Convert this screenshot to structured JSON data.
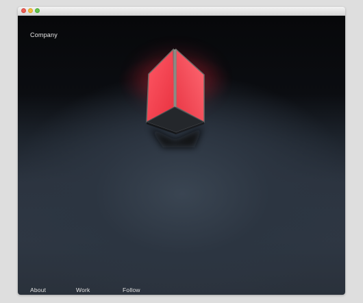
{
  "header": {
    "brand": "Company"
  },
  "footer_nav": {
    "items": [
      {
        "label": "About"
      },
      {
        "label": "Work"
      },
      {
        "label": "Follow"
      }
    ]
  },
  "colors": {
    "lamp_glow": "#ff4b5c",
    "background_dark": "#07080a",
    "background_wall": "#2e3743",
    "nav_text": "#e4e4e4"
  }
}
